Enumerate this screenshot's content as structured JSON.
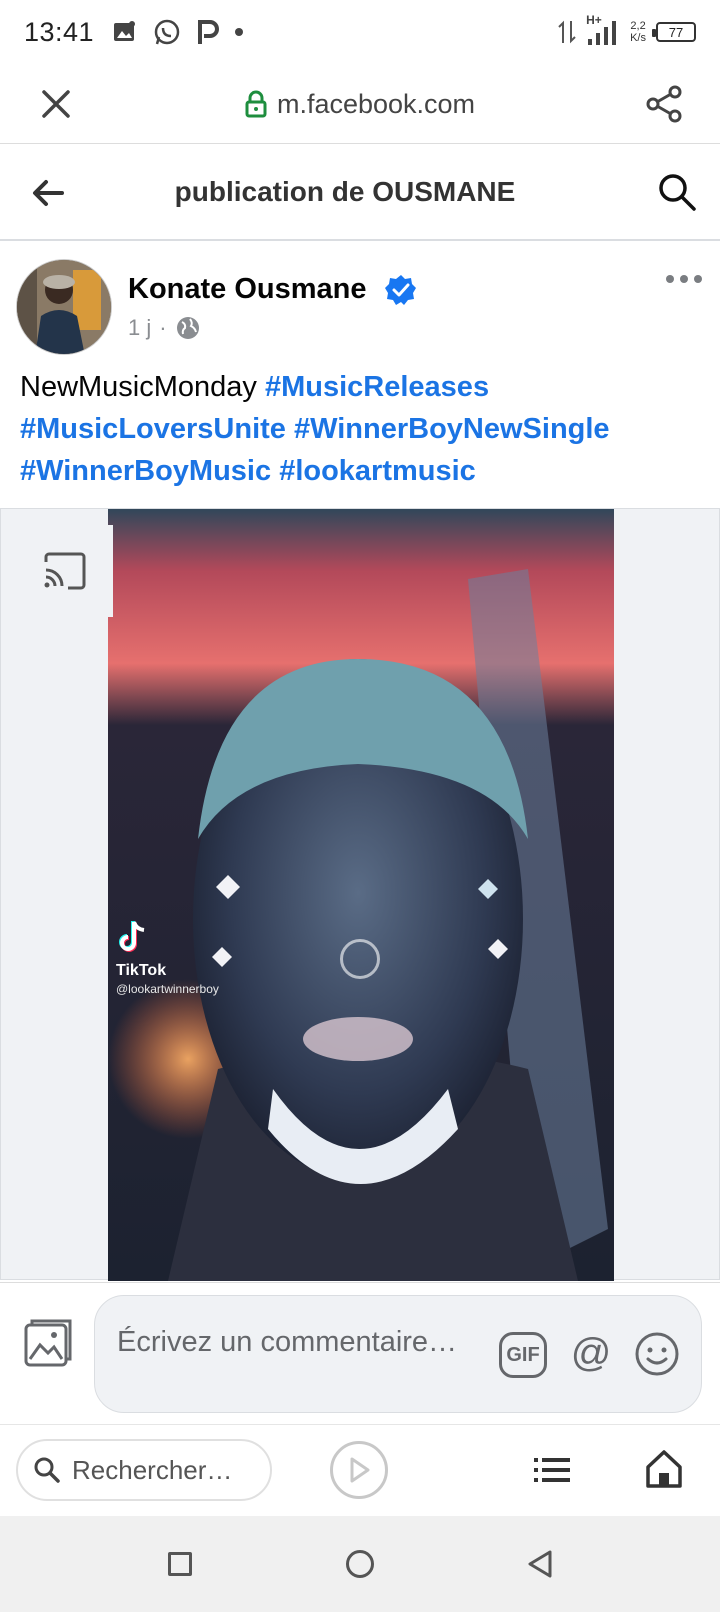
{
  "status_bar": {
    "time": "13:41",
    "net_speed_value": "2,2",
    "net_speed_unit": "K/s",
    "battery": "77",
    "network_type": "H+"
  },
  "browser": {
    "url": "m.facebook.com"
  },
  "page": {
    "title": "publication de OUSMANE"
  },
  "post": {
    "author": "Konate Ousmane",
    "time_ago": "1 j",
    "meta_separator": "·",
    "text_plain": "NewMusicMonday",
    "hashtags": [
      "#MusicReleases",
      "#MusicLoversUnite",
      "#WinnerBoyNewSingle",
      "#WinnerBoyMusic",
      "#lookartmusic"
    ]
  },
  "video": {
    "tiktok_label": "TikTok",
    "tiktok_handle": "@lookartwinnerboy"
  },
  "comment": {
    "placeholder": "Écrivez un commentaire…",
    "gif_label": "GIF",
    "at_label": "@"
  },
  "bottom_bar": {
    "search_placeholder": "Rechercher…"
  },
  "colors": {
    "accent_blue": "#1b74e4",
    "verified_blue": "#1877f2",
    "lock_green": "#1e8e3e"
  }
}
